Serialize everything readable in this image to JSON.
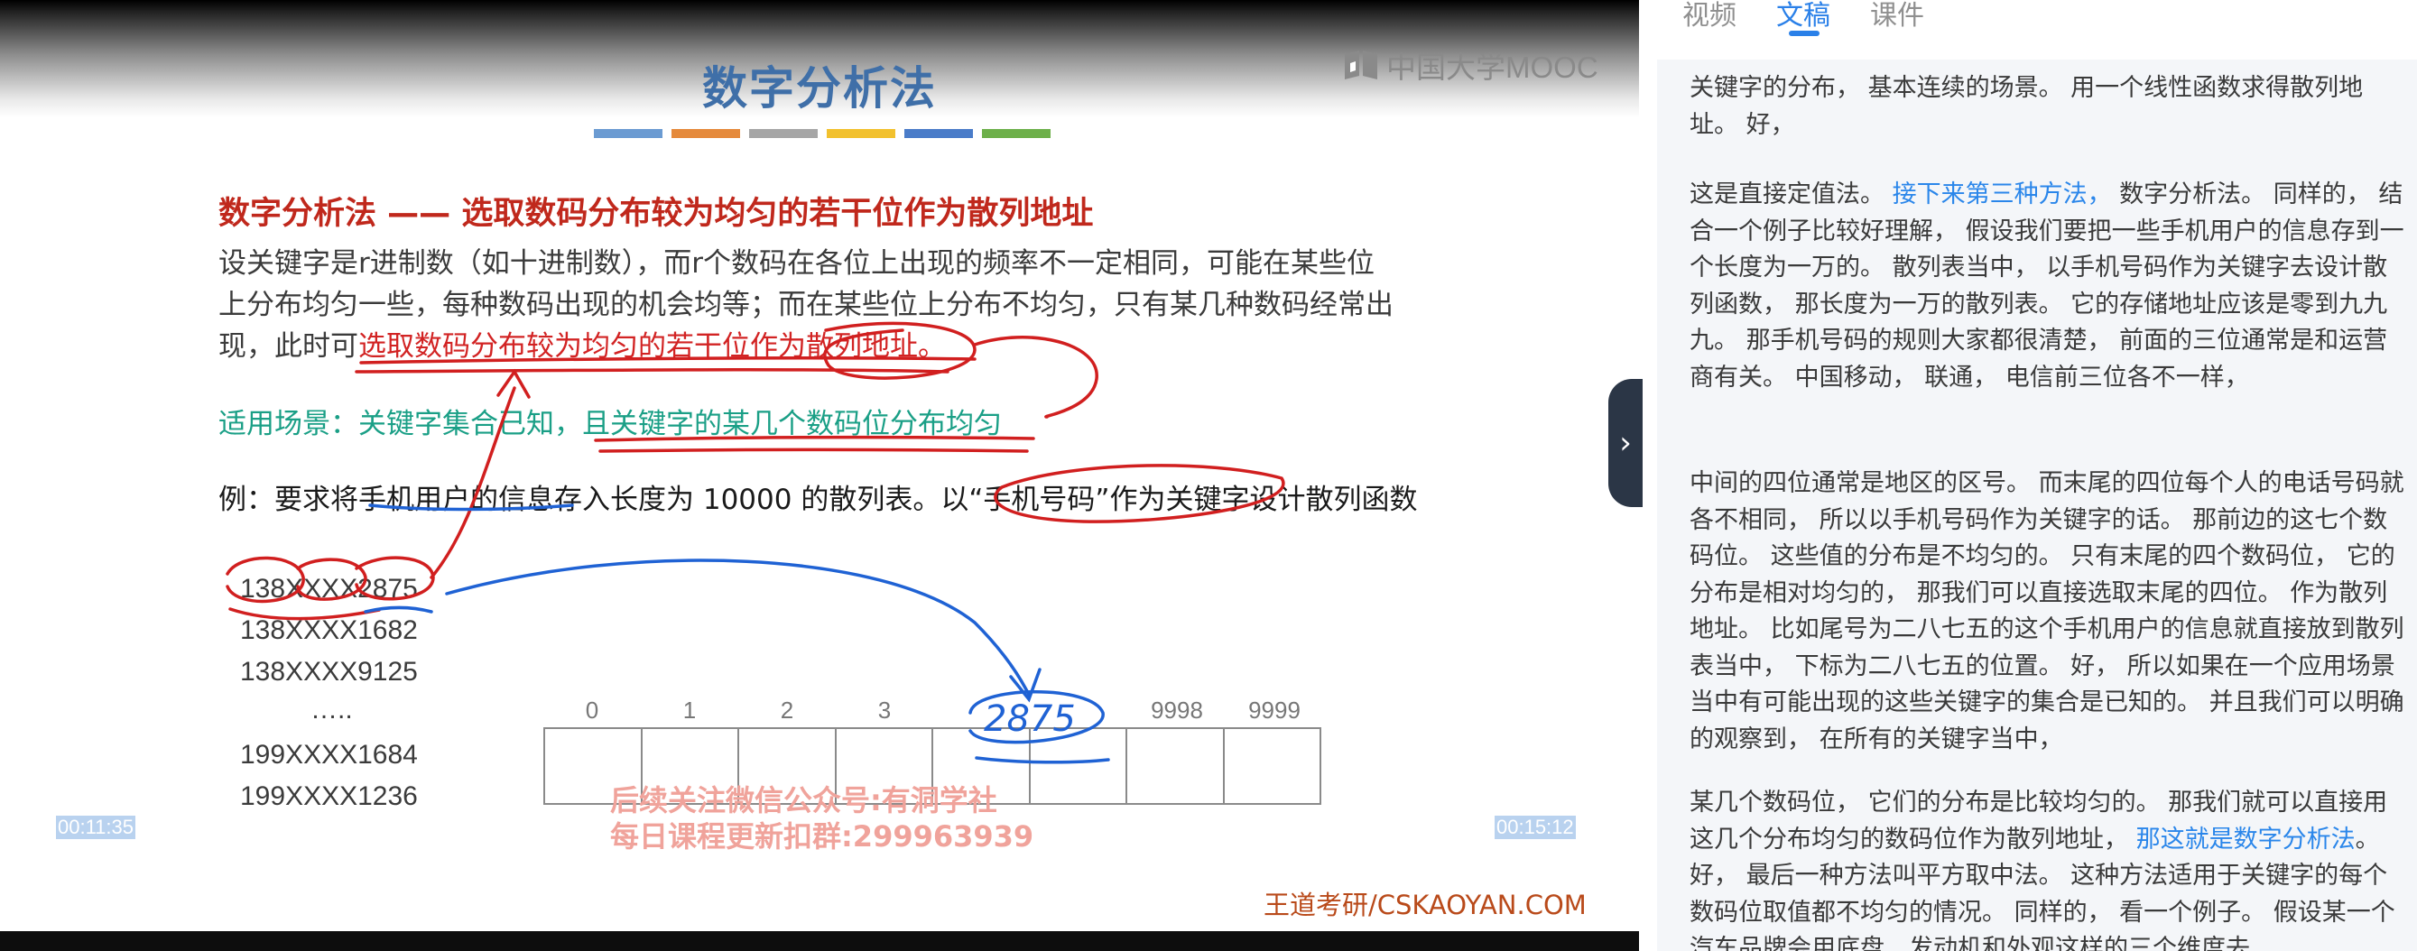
{
  "video": {
    "slide_title": "数字分析法",
    "logo_text": "中国大学MOOC",
    "color_bars": [
      "#6b9bd2",
      "#e58a3c",
      "#a6a6a6",
      "#f2c12e",
      "#4a7cc9",
      "#6db04a"
    ],
    "heading": "数字分析法 —— 选取数码分布较为均匀的若干位作为散列地址",
    "para_line1": "设关键字是r进制数（如十进制数），而r个数码在各位上出现的频率不一定相同，可能在某些位",
    "para_line2": "上分布均匀一些，每种数码出现的机会均等；而在某些位上分布不均匀，只有某几种数码经常出",
    "para_line3_prefix": "现，此时可",
    "para_line3_highlight": "选取数码分布较为均匀的若干位作为散列地址。",
    "scenario_prefix": "适用场景：关键字集合已知，",
    "scenario_rest": "且关键字的某几个数码位分布均匀",
    "example": "例：要求将手机用户的信息存入长度为 10000 的散列表。以“手机号码”作为关键字设计散列函数",
    "phones": [
      "138XXXX2875",
      "138XXXX1682",
      "138XXXX9125",
      "…..",
      "199XXXX1684",
      "199XXXX1236"
    ],
    "table_indices": [
      "0",
      "1",
      "2",
      "3",
      "9998",
      "9999"
    ],
    "handwritten_index": "2875",
    "watermark_line1": "后续关注微信公众号:有洞学社",
    "watermark_line2": "每日课程更新扣群:299963939",
    "time_left": "00:11:35",
    "time_right": "00:15:12",
    "brand": "王道考研/CSKAOYAN.COM"
  },
  "panel": {
    "collapse_icon": "›",
    "tabs": [
      {
        "label": "视频",
        "active": false
      },
      {
        "label": "文稿",
        "active": true
      },
      {
        "label": "课件",
        "active": false
      }
    ],
    "paragraphs": [
      {
        "text": "关键字的分布， 基本连续的场景。 用一个线性函数求得散列地址。 好，",
        "link": ""
      },
      {
        "text": "这是直接定值法。 ",
        "link": "接下来第三种方法，",
        "rest": " 数字分析法。 同样的， 结合一个例子比较好理解， 假设我们要把一些手机用户的信息存到一个长度为一万的。 散列表当中， 以手机号码作为关键字去设计散列函数， 那长度为一万的散列表。 它的存储地址应该是零到九九九。 那手机号码的规则大家都很清楚， 前面的三位通常是和运营商有关。 中国移动， 联通， 电信前三位各不一样，"
      },
      {
        "text": "中间的四位通常是地区的区号。 而末尾的四位每个人的电话号码就各不相同， 所以以手机号码作为关键字的话。 那前边的这七个数码位。 这些值的分布是不均匀的。 只有末尾的四个数码位， 它的分布是相对均匀的， 那我们可以直接选取末尾的四位。 作为散列地址。 比如尾号为二八七五的这个手机用户的信息就直接放到散列表当中， 下标为二八七五的位置。 好， 所以如果在一个应用场景当中有可能出现的这些关键字的集合是已知的。 并且我们可以明确的观察到， 在所有的关键字当中，",
        "link": ""
      },
      {
        "text": "某几个数码位， 它们的分布是比较均匀的。 那我们就可以直接用这几个分布均匀的数码位作为散列地址， ",
        "link": "那这就是数字分析法",
        "rest": "。 好， 最后一种方法叫平方取中法。 这种方法适用于关键字的每个数码位取值都不均匀的情况。 同样的， 看一个例子。 假设某一个汽车品牌会用底盘、发动机和外观这样的三个维度去"
      }
    ]
  }
}
